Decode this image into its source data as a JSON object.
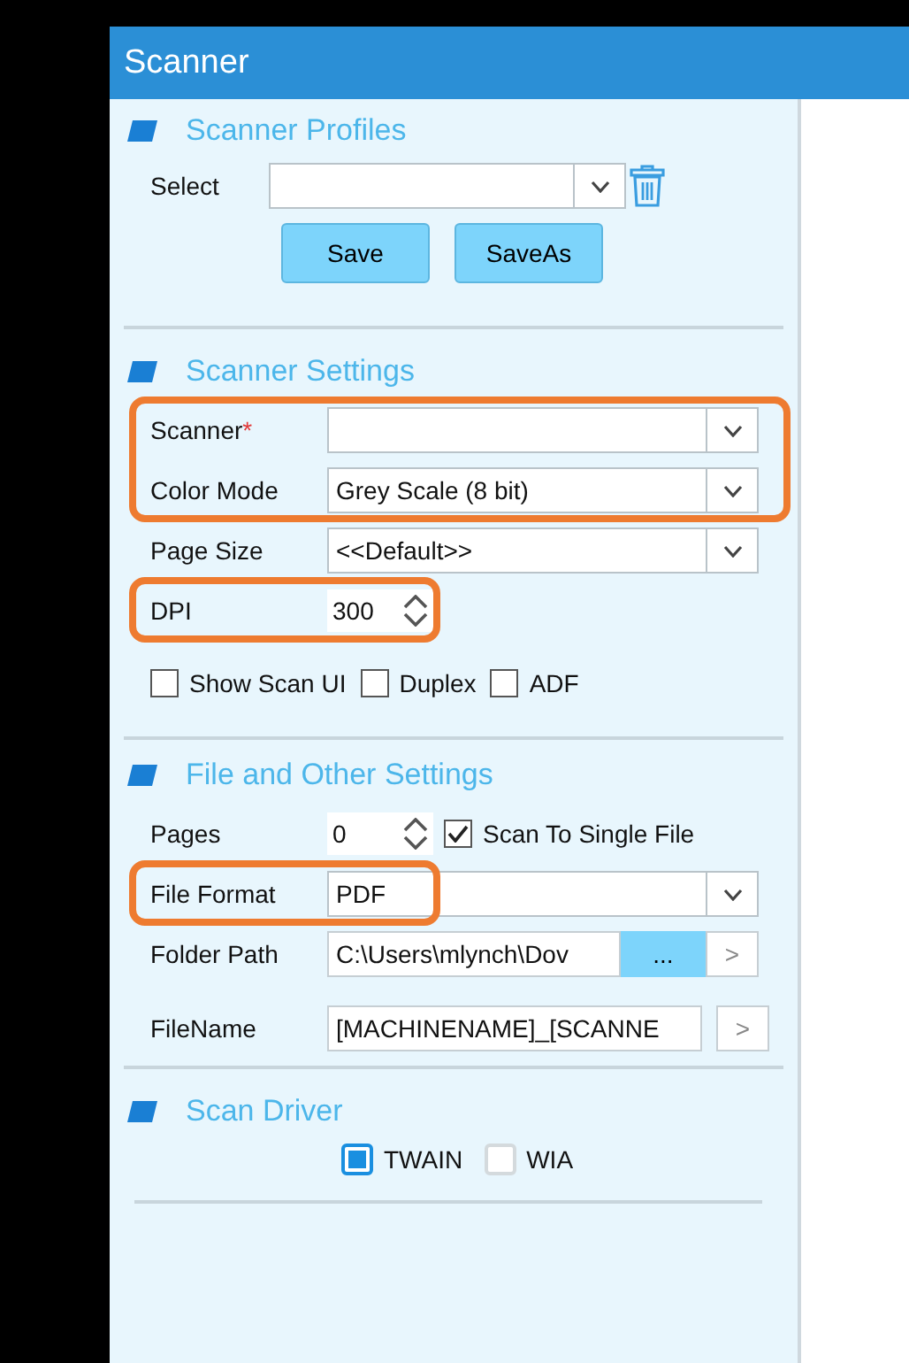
{
  "window": {
    "title": "Scanner"
  },
  "profiles": {
    "title": "Scanner Profiles",
    "select_label": "Select",
    "buttons": [
      "Save",
      "SaveAs"
    ]
  },
  "settings": {
    "title": "Scanner Settings",
    "rows": [
      {
        "kind": "dropdown",
        "label": "Scanner",
        "mark": "*",
        "highlighted": true,
        "highlight_full": true
      },
      {
        "kind": "dropdown",
        "label": "Color Mode",
        "value": "Grey Scale (8 bit)",
        "highlighted": true,
        "highlight_full": true
      },
      {
        "kind": "dropdown",
        "label": "Page Size",
        "value": "<<Default>>",
        "highlighted": false
      },
      {
        "kind": "spinner",
        "label": "DPI",
        "value": "300",
        "highlighted": true,
        "highlight_full": false
      }
    ],
    "checkboxes": [
      {
        "label": "Show Scan UI",
        "checked": false
      },
      {
        "label": "Duplex",
        "checked": false
      },
      {
        "label": "ADF",
        "checked": false
      }
    ]
  },
  "file_settings": {
    "title": "File and Other Settings",
    "rows": [
      {
        "kind": "spinner",
        "label": "Pages",
        "value": "0",
        "highlighted": false,
        "checkbox": {
          "label": "Scan To Single File",
          "checked": true
        }
      },
      {
        "kind": "dropdown",
        "label": "File Format",
        "value": "PDF",
        "highlighted": true,
        "highlight_full": false
      },
      {
        "kind": "path",
        "label": "Folder Path",
        "value": "C:\\Users\\mlynch\\Dov",
        "browse": "...",
        "go": ">",
        "highlighted": false
      },
      {
        "kind": "text",
        "label": "FileName",
        "value": "[MACHINENAME]_[SCANNE",
        "go": ">",
        "highlighted": false
      }
    ]
  },
  "driver": {
    "title": "Scan Driver",
    "options": [
      {
        "label": "TWAIN",
        "selected": true
      },
      {
        "label": "WIA",
        "selected": false
      }
    ]
  }
}
